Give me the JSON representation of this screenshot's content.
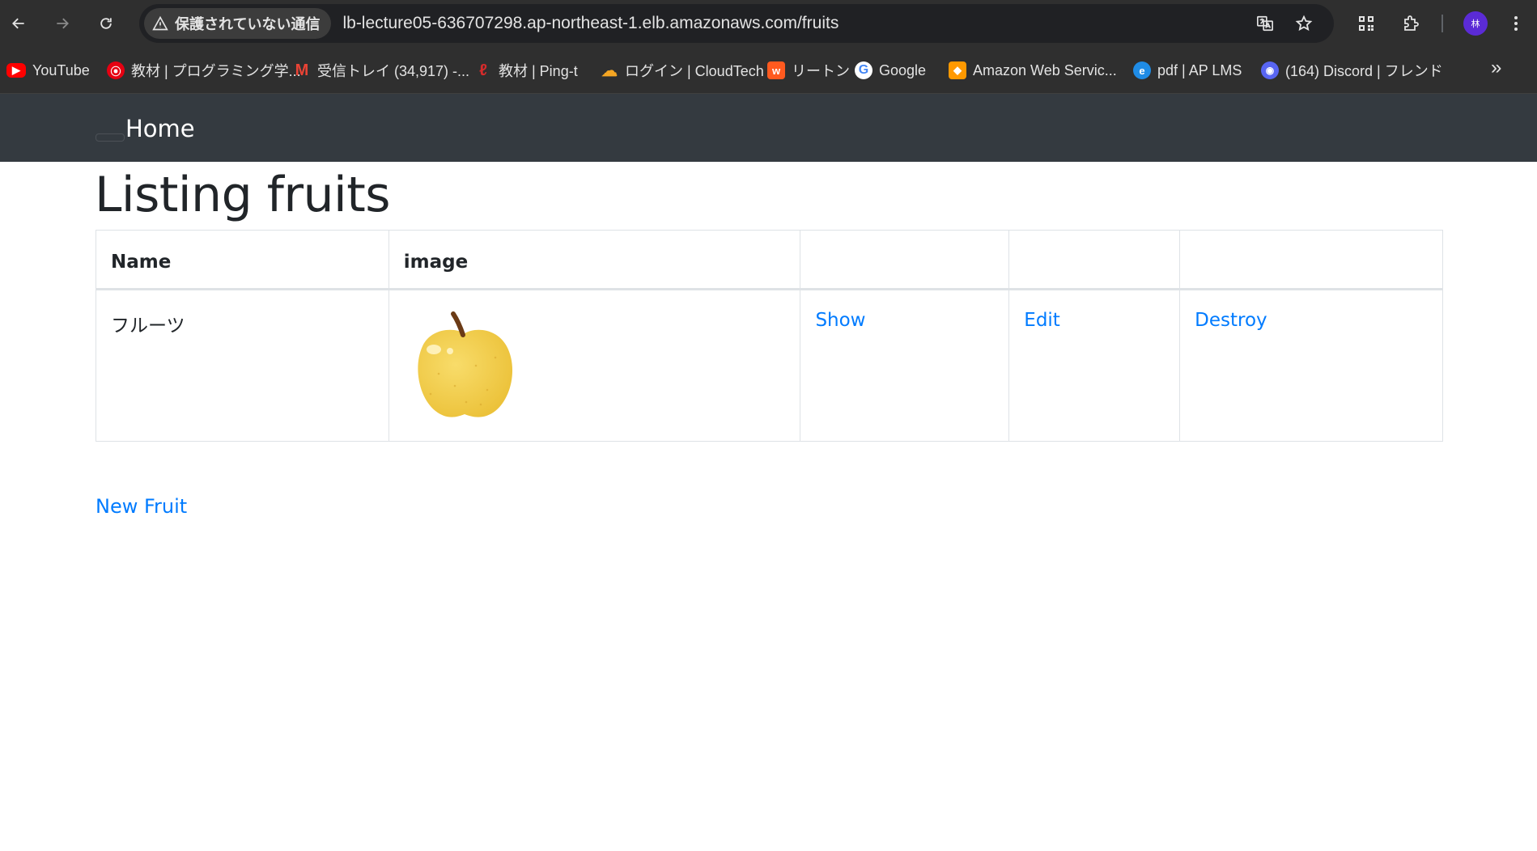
{
  "browser": {
    "security_label": "保護されていない通信",
    "url": "lb-lecture05-636707298.ap-northeast-1.elb.amazonaws.com/fruits",
    "avatar_initial": "林",
    "bookmarks": [
      {
        "label": "YouTube",
        "icon": "youtube-icon",
        "color": "#ff0000"
      },
      {
        "label": "教材 | プログラミング学...",
        "icon": "techacademy-icon",
        "color": "#e60012"
      },
      {
        "label": "受信トレイ (34,917) -...",
        "icon": "gmail-icon",
        "color": "#ea4335"
      },
      {
        "label": "教材 | Ping-t",
        "icon": "pingt-icon",
        "color": "#d62b2b"
      },
      {
        "label": "ログイン | CloudTech",
        "icon": "cloud-icon",
        "color": "#f5a623"
      },
      {
        "label": "リートン",
        "icon": "wrtn-icon",
        "color": "#ff5a1f"
      },
      {
        "label": "Google",
        "icon": "google-icon",
        "color": "#4285f4"
      },
      {
        "label": "Amazon Web Servic...",
        "icon": "aws-icon",
        "color": "#ff9900"
      },
      {
        "label": "pdf | AP LMS",
        "icon": "edge-icon",
        "color": "#1f8ce6"
      },
      {
        "label": "(164) Discord | フレンド",
        "icon": "discord-icon",
        "color": "#5865f2"
      }
    ]
  },
  "navbar": {
    "brand": "Home"
  },
  "page": {
    "title": "Listing fruits",
    "table": {
      "headers": [
        "Name",
        "image",
        "",
        "",
        ""
      ],
      "rows": [
        {
          "name": "フルーツ",
          "image": "yellow-apple-image",
          "show": "Show",
          "edit": "Edit",
          "destroy": "Destroy"
        }
      ]
    },
    "new_link": "New Fruit"
  },
  "colors": {
    "navbar_bg": "#343a40",
    "link": "#007bff",
    "text": "#212529"
  }
}
